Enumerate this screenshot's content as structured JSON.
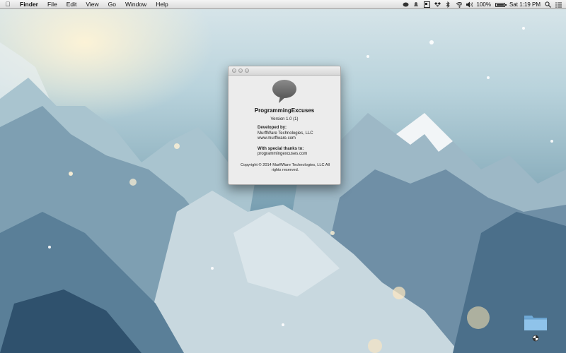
{
  "menubar": {
    "apple_icon": "apple-logo-icon",
    "app_name": "Finder",
    "items": [
      "File",
      "Edit",
      "View",
      "Go",
      "Window",
      "Help"
    ],
    "status": {
      "icons": [
        "messages-icon",
        "notification-icon",
        "display-icon",
        "dropbox-icon",
        "bluetooth-icon",
        "wifi-icon",
        "volume-icon"
      ],
      "battery_percent": "100%",
      "clock": "Sat 1:19 PM",
      "search_icon": "spotlight-search-icon",
      "list_icon": "notification-center-icon"
    }
  },
  "about_window": {
    "app_icon": "speech-bubble-icon",
    "app_name": "ProgrammingExcuses",
    "version": "Version 1.0 (1)",
    "developed_by_heading": "Developed by:",
    "developer_name": "MurffWare Technologies, LLC",
    "developer_url": "www.murffware.com",
    "thanks_heading": "With special thanks to:",
    "thanks_url": "programmingexcuses.com",
    "copyright": "Copyright © 2014 MurffWare Technologies, LLC All rights reserved."
  },
  "desktop": {
    "folder_icon": "folder-icon",
    "cursor_icon": "busy-cursor-icon"
  }
}
